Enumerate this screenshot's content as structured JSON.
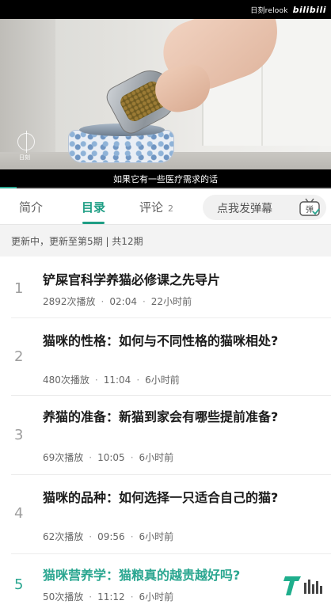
{
  "player": {
    "brand_text": "日刻relook",
    "brand_logo": "bilibili",
    "watermark_text": "日刻",
    "subtitle": "如果它有一些医疗需求的话",
    "progress_fraction": 0.05,
    "accent_color": "#2aa690"
  },
  "tabs": [
    {
      "label": "简介",
      "active": false
    },
    {
      "label": "目录",
      "active": true
    },
    {
      "label": "评论",
      "count": "2",
      "active": false
    }
  ],
  "danmaku": {
    "placeholder": "点我发弹幕",
    "button_icon": "danmaku-tv-icon",
    "button_label": "弹"
  },
  "update_status": "更新中，更新至第5期 | 共12期",
  "episodes": [
    {
      "num": "1",
      "title": "铲屎官科学养猫必修课之先导片",
      "plays": "2892次播放",
      "duration": "02:04",
      "time": "22小时前",
      "current": false
    },
    {
      "num": "2",
      "title": "猫咪的性格：如何与不同性格的猫咪相处?",
      "plays": "480次播放",
      "duration": "11:04",
      "time": "6小时前",
      "current": false
    },
    {
      "num": "3",
      "title": "养猫的准备：新猫到家会有哪些提前准备?",
      "plays": "69次播放",
      "duration": "10:05",
      "time": "6小时前",
      "current": false
    },
    {
      "num": "4",
      "title": "猫咪的品种：如何选择一只适合自己的猫?",
      "plays": "62次播放",
      "duration": "09:56",
      "time": "6小时前",
      "current": false
    },
    {
      "num": "5",
      "title": "猫咪营养学：猫粮真的越贵越好吗?",
      "plays": "50次播放",
      "duration": "11:12",
      "time": "6小时前",
      "current": true
    }
  ],
  "corner_badge": {
    "icon": "tmt-logo-icon",
    "label": "T"
  }
}
